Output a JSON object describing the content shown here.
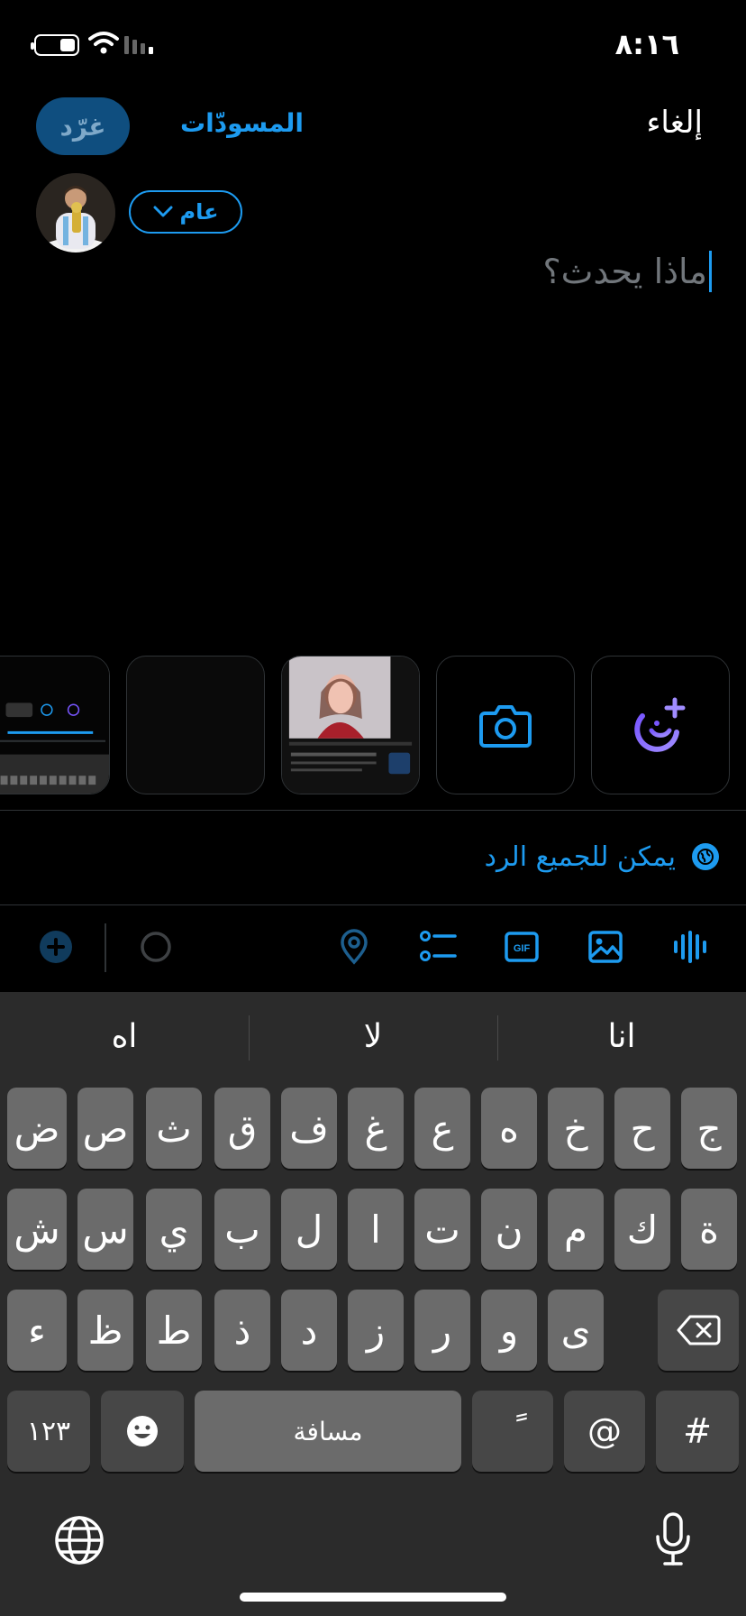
{
  "status_bar": {
    "time": "٨:١٦"
  },
  "header": {
    "cancel_label": "إلغاء",
    "drafts_label": "المسودّات",
    "post_label": "غرّد"
  },
  "composer": {
    "audience_label": "عام",
    "placeholder": "ماذا يحدث؟"
  },
  "reply_setting": {
    "label": "يمكن للجميع الرد"
  },
  "media_tiles": [
    "add-to-story-icon",
    "camera-icon",
    "recent-photo-1",
    "recent-photo-2",
    "recent-photo-3"
  ],
  "toolbar": {
    "icons": [
      "audio-icon",
      "image-icon",
      "gif-icon",
      "poll-icon",
      "location-icon",
      "progress-circle-icon",
      "add-thread-icon"
    ],
    "gif_text": "GIF"
  },
  "keyboard": {
    "suggestions": [
      "انا",
      "لا",
      "اه"
    ],
    "row1": [
      "ج",
      "ح",
      "خ",
      "ه",
      "ع",
      "غ",
      "ف",
      "ق",
      "ث",
      "ص",
      "ض"
    ],
    "row2": [
      "ة",
      "ك",
      "م",
      "ن",
      "ت",
      "ا",
      "ل",
      "ب",
      "ي",
      "س",
      "ش"
    ],
    "row3": [
      "ى",
      "و",
      "ر",
      "ز",
      "د",
      "ذ",
      "ط",
      "ظ",
      "ء"
    ],
    "bottom": {
      "numbers": "١٢٣",
      "space": "مسافة",
      "diacritic": "ً",
      "at": "@",
      "hash": "#"
    }
  },
  "colors": {
    "accent": "#1d9bf0",
    "post_button_bg": "#0f4e7f",
    "keyboard_bg": "#2b2b2b",
    "key_bg": "#6b6b6b"
  }
}
